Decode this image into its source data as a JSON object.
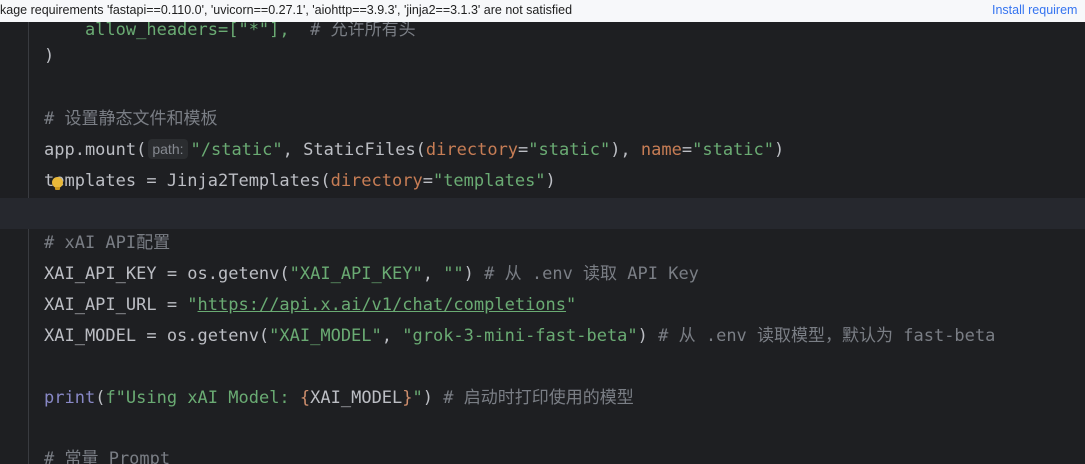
{
  "banner": {
    "message": "kage requirements 'fastapi==0.110.0', 'uvicorn==0.27.1', 'aiohttp==3.9.3', 'jinja2==3.1.3' are not satisfied",
    "action": "Install requirem"
  },
  "code": {
    "l1_a": "    allow_headers=[\"*\"],",
    "l1_b": "  # 允许所有头",
    "l2": ")",
    "l4": "# 设置静态文件和模板",
    "l5_a": "app.mount(",
    "l5_hint": "path:",
    "l5_b": "\"/static\"",
    "l5_c": ", StaticFiles(",
    "l5_d": "directory",
    "l5_e": "=",
    "l5_f": "\"static\"",
    "l5_g": "), ",
    "l5_h": "name",
    "l5_i": "=",
    "l5_j": "\"static\"",
    "l5_k": ")",
    "l6_a": "templates = Jinja2Templates(",
    "l6_b": "directory",
    "l6_c": "=",
    "l6_d": "\"templates\"",
    "l6_e": ")",
    "l8": "# xAI API配置",
    "l9_a": "XAI_API_KEY = os.getenv(",
    "l9_b": "\"XAI_API_KEY\"",
    "l9_c": ", ",
    "l9_d": "\"\"",
    "l9_e": ") ",
    "l9_f": "# 从 .env 读取 API Key",
    "l10_a": "XAI_API_URL = ",
    "l10_q1": "\"",
    "l10_url": "https://api.x.ai/v1/chat/completions",
    "l10_q2": "\"",
    "l11_a": "XAI_MODEL = os.getenv(",
    "l11_b": "\"XAI_MODEL\"",
    "l11_c": ", ",
    "l11_d": "\"grok-3-mini-fast-beta\"",
    "l11_e": ") ",
    "l11_f": "# 从 .env 读取模型，默认为 fast-beta",
    "l13_a": "print",
    "l13_b": "(",
    "l13_c": "f\"Using xAI Model: ",
    "l13_d": "{",
    "l13_e": "XAI_MODEL",
    "l13_f": "}",
    "l13_g": "\"",
    "l13_h": ") ",
    "l13_i": "# 启动时打印使用的模型",
    "l15": "# 常量 Prompt"
  },
  "icons": {
    "intention": "lightbulb-icon"
  },
  "colors": {
    "background": "#1e1f22",
    "comment": "#7a7e85",
    "string": "#6aab73",
    "parameter": "#c77d55",
    "builtin": "#8888c6",
    "link": "#3574f0"
  }
}
